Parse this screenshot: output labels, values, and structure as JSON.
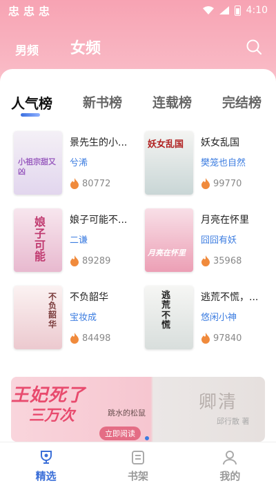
{
  "status_bar": {
    "app_icons": [
      "忠",
      "忠",
      "忠"
    ],
    "time": "4:10"
  },
  "gender_tabs": [
    {
      "label": "男频",
      "active": false
    },
    {
      "label": "女频",
      "active": true
    }
  ],
  "rank_tabs": [
    {
      "label": "人气榜",
      "active": true
    },
    {
      "label": "新书榜",
      "active": false
    },
    {
      "label": "连载榜",
      "active": false
    },
    {
      "label": "完结榜",
      "active": false
    }
  ],
  "books": [
    {
      "title": "景先生的小...",
      "author": "兮浠",
      "heat": "80772",
      "cover_text": "小祖宗甜又凶",
      "cover_bg": "#e9e2f0",
      "cover_accent": "#9b5fc0"
    },
    {
      "title": "妖女乱国",
      "author": "樊笼也自然",
      "heat": "99770",
      "cover_text": "妖女乱国",
      "cover_bg": "#e8ecec",
      "cover_accent": "#b02020"
    },
    {
      "title": "娘子可能不...",
      "author": "二谦",
      "heat": "89289",
      "cover_text": "娘子可能",
      "cover_bg": "#f4dce6",
      "cover_accent": "#c03a70"
    },
    {
      "title": "月亮在怀里",
      "author": "囧囧有妖",
      "heat": "35968",
      "cover_text": "月亮在怀里",
      "cover_bg": "#f6d4df",
      "cover_accent": "#ffffff"
    },
    {
      "title": "不负韶华",
      "author": "宝妆成",
      "heat": "84498",
      "cover_text": "不负韶华",
      "cover_bg": "#f5e8e8",
      "cover_accent": "#7a3b3b"
    },
    {
      "title": "逃荒不慌，...",
      "author": "悠闲小神",
      "heat": "97840",
      "cover_text": "逃荒不慌",
      "cover_bg": "#eef0ee",
      "cover_accent": "#222222"
    }
  ],
  "banner": {
    "left_title_1": "王妃死了",
    "left_title_2": "三万次",
    "left_author": "跳水的松鼠",
    "read_button": "立即阅读",
    "right_title": "卿清",
    "right_author": "邱行散 著"
  },
  "bottom_nav": [
    {
      "label": "精选",
      "active": true,
      "icon": "trophy-icon"
    },
    {
      "label": "书架",
      "active": false,
      "icon": "bookshelf-icon"
    },
    {
      "label": "我的",
      "active": false,
      "icon": "user-icon"
    }
  ],
  "colors": {
    "header_pink": "#f7a3b3",
    "author_blue": "#3b7ce0",
    "active_nav_blue": "#3b6fd8",
    "flame_orange": "#f08a3c"
  }
}
